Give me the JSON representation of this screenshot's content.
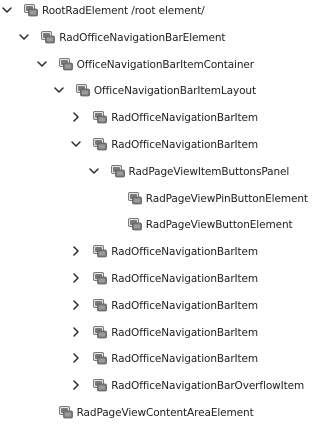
{
  "tree": {
    "nodes": [
      {
        "label": "RootRadElement /root element/",
        "depth": 0,
        "state": "expanded",
        "icon": "element-icon"
      },
      {
        "label": "RadOfficeNavigationBarElement",
        "depth": 1,
        "state": "expanded",
        "icon": "element-icon"
      },
      {
        "label": "OfficeNavigationBarItemContainer",
        "depth": 2,
        "state": "expanded",
        "icon": "element-icon"
      },
      {
        "label": "OfficeNavigationBarItemLayout",
        "depth": 3,
        "state": "expanded",
        "icon": "element-icon"
      },
      {
        "label": "RadOfficeNavigationBarItem",
        "depth": 4,
        "state": "collapsed",
        "icon": "element-icon"
      },
      {
        "label": "RadOfficeNavigationBarItem",
        "depth": 4,
        "state": "expanded",
        "icon": "element-icon"
      },
      {
        "label": "RadPageViewItemButtonsPanel",
        "depth": 5,
        "state": "expanded",
        "icon": "element-icon"
      },
      {
        "label": "RadPageViewPinButtonElement",
        "depth": 6,
        "state": "leaf",
        "icon": "element-icon"
      },
      {
        "label": "RadPageViewButtonElement",
        "depth": 6,
        "state": "leaf",
        "icon": "element-icon"
      },
      {
        "label": "RadOfficeNavigationBarItem",
        "depth": 4,
        "state": "collapsed",
        "icon": "element-icon"
      },
      {
        "label": "RadOfficeNavigationBarItem",
        "depth": 4,
        "state": "collapsed",
        "icon": "element-icon"
      },
      {
        "label": "RadOfficeNavigationBarItem",
        "depth": 4,
        "state": "collapsed",
        "icon": "element-icon"
      },
      {
        "label": "RadOfficeNavigationBarItem",
        "depth": 4,
        "state": "collapsed",
        "icon": "element-icon"
      },
      {
        "label": "RadOfficeNavigationBarItem",
        "depth": 4,
        "state": "collapsed",
        "icon": "element-icon"
      },
      {
        "label": "RadOfficeNavigationBarOverflowItem",
        "depth": 4,
        "state": "collapsed",
        "icon": "element-icon"
      },
      {
        "label": "RadPageViewContentAreaElement",
        "depth": 2,
        "state": "leaf",
        "icon": "element-icon"
      }
    ]
  },
  "colors": {
    "text": "#1f1f1f",
    "chevron": "#2b2b2b",
    "icon_body": "#7a7a7a",
    "icon_light": "#e6e6e6"
  }
}
